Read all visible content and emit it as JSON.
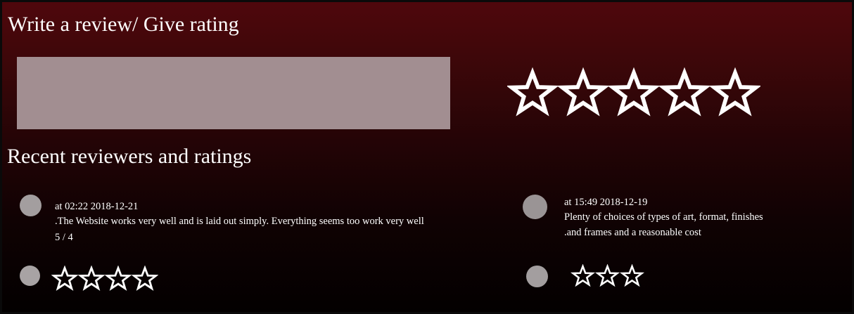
{
  "write_section": {
    "title": "Write a review/ Give rating",
    "review_input_value": "",
    "rating_star_count": 5,
    "rating_value": 0,
    "star_icon": "star-outline-icon",
    "star_color": "#ffffff"
  },
  "recent_section": {
    "title": "Recent reviewers and ratings",
    "reviews": [
      {
        "time": "at 02:22 2018-12-21",
        "text": ".The Website works very well and is laid out simply. Everything seems too work very well",
        "score": "5 / 4",
        "stars": 4
      },
      {
        "time": "at 15:49 2018-12-19",
        "text_line1": "Plenty of choices of types of art, format, finishes",
        "text_line2": ".and frames and a reasonable cost",
        "stars": 3
      }
    ]
  },
  "colors": {
    "background_top": "#4f070c",
    "background_bottom": "#030000",
    "input_fill": "#a28e91",
    "avatar": "#9e9899",
    "text": "#ffffff"
  }
}
